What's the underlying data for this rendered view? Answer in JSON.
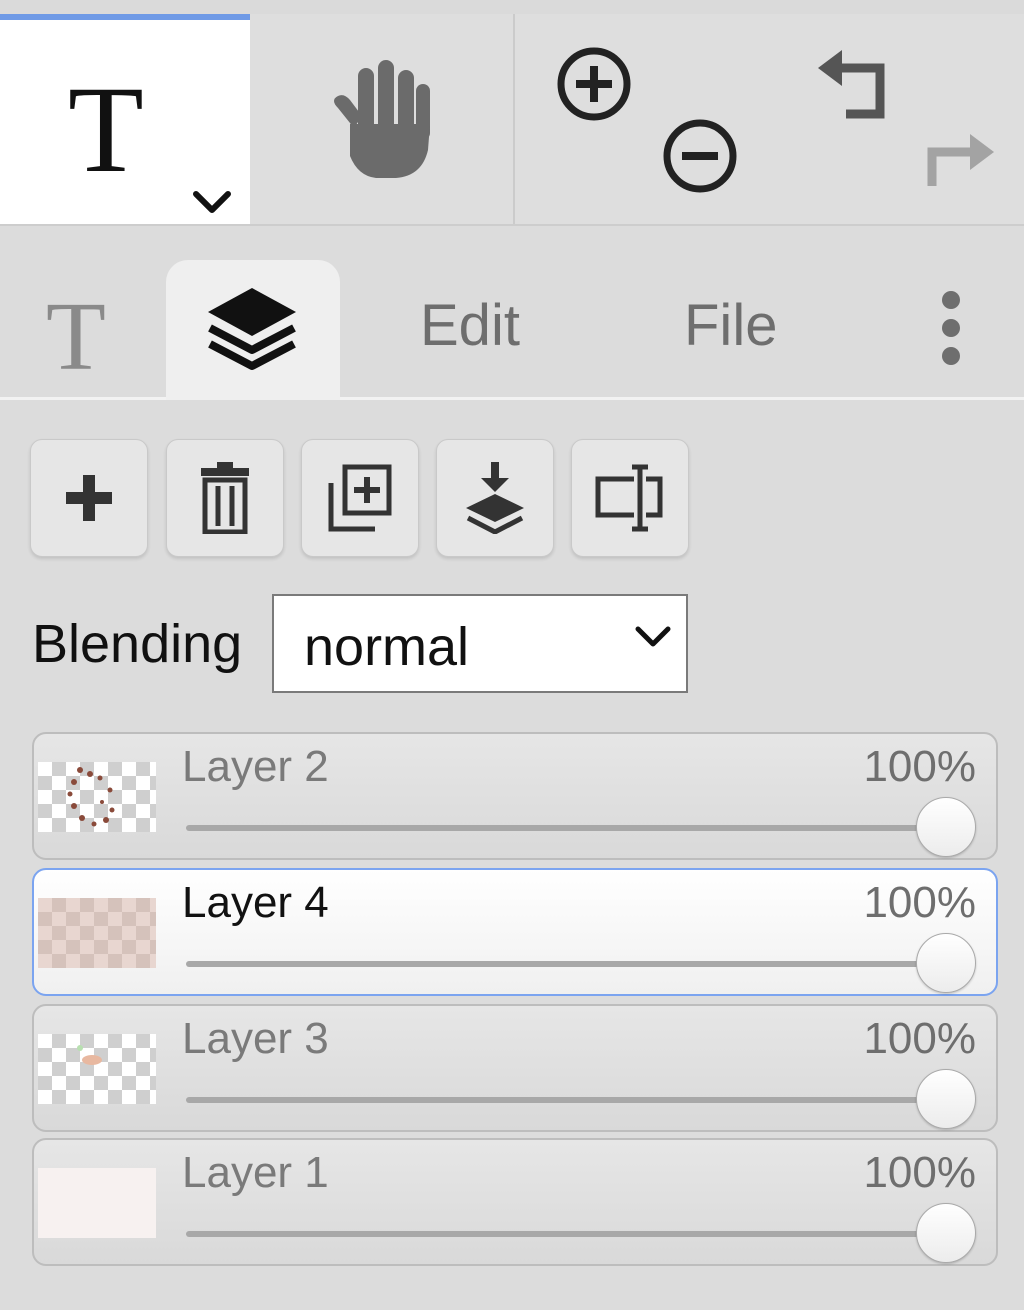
{
  "toolbar": {
    "active_tool": "T",
    "tools": [
      "text-tool",
      "pan-tool",
      "zoom-in",
      "zoom-out",
      "undo",
      "redo"
    ]
  },
  "tabs": {
    "text_tab_icon": "T",
    "edit": "Edit",
    "file": "File"
  },
  "layers_panel": {
    "actions": [
      "add-layer-icon",
      "delete-layer-icon",
      "duplicate-layer-icon",
      "merge-down-icon",
      "crop-layer-icon"
    ],
    "blending_label": "Blending",
    "blending_value": "normal",
    "layers": [
      {
        "name": "Layer 2",
        "opacity_label": "100%",
        "opacity": 1.0,
        "selected": false,
        "thumb": "checker-wreath"
      },
      {
        "name": "Layer 4",
        "opacity_label": "100%",
        "opacity": 1.0,
        "selected": true,
        "thumb": "checker-tinted"
      },
      {
        "name": "Layer 3",
        "opacity_label": "100%",
        "opacity": 1.0,
        "selected": false,
        "thumb": "checker-sketch"
      },
      {
        "name": "Layer 1",
        "opacity_label": "100%",
        "opacity": 1.0,
        "selected": false,
        "thumb": "solid"
      }
    ]
  },
  "colors": {
    "accent": "#6f9ae6",
    "selected_border": "#7ba4f0",
    "panel_bg": "#dcdcdc"
  }
}
